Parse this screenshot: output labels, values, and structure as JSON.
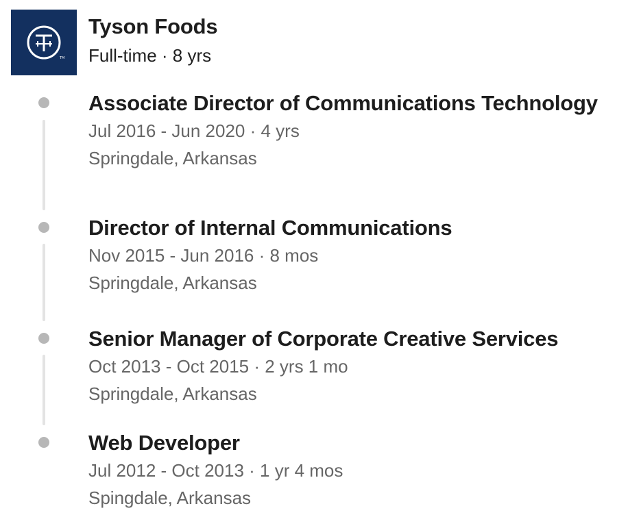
{
  "company": {
    "name": "Tyson Foods",
    "meta": "Full-time · 8 yrs",
    "logo_icon": "tyson-logo-icon",
    "logo_bg_color": "#13305f"
  },
  "positions": [
    {
      "title": "Associate Director of Communications Technology",
      "dates": "Jul 2016 - Jun 2020 · 4 yrs",
      "location": "Springdale, Arkansas"
    },
    {
      "title": "Director of Internal Communications",
      "dates": "Nov 2015 - Jun 2016 · 8 mos",
      "location": "Springdale, Arkansas"
    },
    {
      "title": "Senior Manager of Corporate Creative Services",
      "dates": "Oct 2013 - Oct 2015 · 2 yrs 1 mo",
      "location": "Springdale, Arkansas"
    },
    {
      "title": "Web Developer",
      "dates": "Jul 2012 - Oct 2013 · 1 yr 4 mos",
      "location": "Spingdale, Arkansas"
    }
  ]
}
